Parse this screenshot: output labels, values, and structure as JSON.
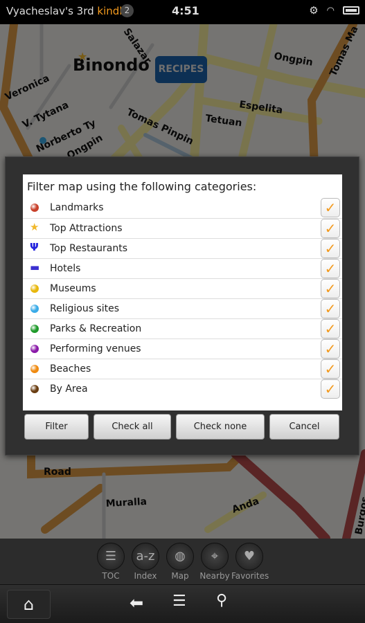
{
  "status_bar": {
    "device_name": "Vyacheslav's 3rd ",
    "brand": "kindle",
    "notification_count": "2",
    "time": "4:51",
    "icons": [
      "gear-icon",
      "wifi-icon",
      "battery-icon"
    ]
  },
  "map": {
    "place_label": "Binondo",
    "recipes_label": "RECIPES",
    "streets": [
      "Veronica",
      "V. Tytana",
      "Norberto Ty",
      "Ongpin",
      "Salazar",
      "Tomas Pinpin",
      "Espelita",
      "Tetuan",
      "Ongpin",
      "Tomas Ma",
      "Road",
      "Muralla",
      "Anda",
      "Burgos"
    ]
  },
  "dialog": {
    "title": "Filter map using the following categories:",
    "categories": [
      {
        "label": "Landmarks",
        "icon": "red-dot-icon",
        "color": "#c8402a",
        "checked": true
      },
      {
        "label": "Top Attractions",
        "icon": "star-icon",
        "color": "#f1b82b",
        "checked": true
      },
      {
        "label": "Top Restaurants",
        "icon": "fork-knife-icon",
        "color": "#2222dd",
        "checked": true
      },
      {
        "label": "Hotels",
        "icon": "bed-icon",
        "color": "#3a2fd0",
        "checked": true
      },
      {
        "label": "Museums",
        "icon": "yellow-dot-icon",
        "color": "#e8b70c",
        "checked": true
      },
      {
        "label": "Religious sites",
        "icon": "blue-dot-icon",
        "color": "#3aabe8",
        "checked": true
      },
      {
        "label": "Parks & Recreation",
        "icon": "green-dot-icon",
        "color": "#1e9a2a",
        "checked": true
      },
      {
        "label": "Performing venues",
        "icon": "purple-dot-icon",
        "color": "#8a1aa8",
        "checked": true
      },
      {
        "label": "Beaches",
        "icon": "orange-dot-icon",
        "color": "#ef8a10",
        "checked": true
      },
      {
        "label": "By Area",
        "icon": "brown-dot-icon",
        "color": "#6a3e12",
        "checked": true
      }
    ],
    "buttons": {
      "filter": "Filter",
      "check_all": "Check all",
      "check_none": "Check none",
      "cancel": "Cancel"
    }
  },
  "toolbar": [
    {
      "label": "TOC",
      "icon": "list-icon"
    },
    {
      "label": "Index",
      "icon": "a-z-icon",
      "glyph": "a-z"
    },
    {
      "label": "Map",
      "icon": "globe-icon"
    },
    {
      "label": "Nearby",
      "icon": "crosshair-icon"
    },
    {
      "label": "Favorites",
      "icon": "heart-icon"
    }
  ],
  "colors": {
    "accent": "#f39a1e"
  }
}
